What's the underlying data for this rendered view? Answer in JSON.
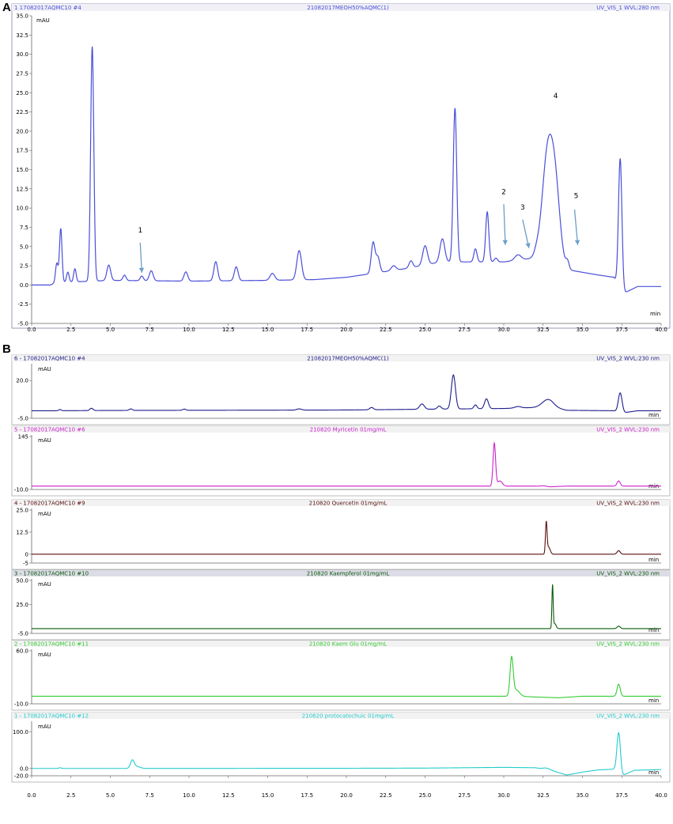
{
  "chart_data": [
    {
      "type": "line",
      "panel_label": "A",
      "header": {
        "left": "1 17082017AQMC10 #4",
        "center": "21082017MEOH50%AQMC(1)",
        "right": "UV_VIS_1 WVL:280 nm"
      },
      "ylabel": "mAU",
      "xlabel": "min",
      "xlim": [
        0.0,
        40.0
      ],
      "ylim": [
        -5.0,
        35.0
      ],
      "xticks": [
        "0.0",
        "2.5",
        "5.0",
        "7.5",
        "10.0",
        "12.5",
        "15.0",
        "17.5",
        "20.0",
        "22.5",
        "25.0",
        "27.5",
        "30.0",
        "32.5",
        "35.0",
        "37.5",
        "40.0"
      ],
      "yticks": [
        "-5.0",
        "-2.5",
        "0.0",
        "2.5",
        "5.0",
        "7.5",
        "10.0",
        "12.5",
        "15.0",
        "17.5",
        "20.0",
        "22.5",
        "25.0",
        "27.5",
        "30.0",
        "32.5",
        "35.0"
      ],
      "color": "#4a4fd8",
      "baseline": [
        [
          0.0,
          0.0
        ],
        [
          1.2,
          0.0
        ],
        [
          1.5,
          0.3
        ],
        [
          5.0,
          0.6
        ],
        [
          10.0,
          0.5
        ],
        [
          15.0,
          0.6
        ],
        [
          18.0,
          0.7
        ],
        [
          20.0,
          1.0
        ],
        [
          22.0,
          1.6
        ],
        [
          24.0,
          2.2
        ],
        [
          26.0,
          3.0
        ],
        [
          28.0,
          3.0
        ],
        [
          30.0,
          3.0
        ],
        [
          32.0,
          3.5
        ],
        [
          34.0,
          2.0
        ],
        [
          36.0,
          1.3
        ],
        [
          37.0,
          1.0
        ],
        [
          37.5,
          -1.2
        ],
        [
          38.5,
          -0.2
        ],
        [
          40.0,
          -0.2
        ]
      ],
      "peaks": [
        [
          1.6,
          2.5,
          0.08
        ],
        [
          1.85,
          7.0,
          0.08
        ],
        [
          2.3,
          1.3,
          0.08
        ],
        [
          2.75,
          1.7,
          0.08
        ],
        [
          3.85,
          30.5,
          0.1
        ],
        [
          4.9,
          2.0,
          0.12
        ],
        [
          5.9,
          0.7,
          0.1
        ],
        [
          7.0,
          0.6,
          0.1
        ],
        [
          7.6,
          1.3,
          0.12
        ],
        [
          9.8,
          1.2,
          0.12
        ],
        [
          11.7,
          2.5,
          0.12
        ],
        [
          13.0,
          1.8,
          0.12
        ],
        [
          15.3,
          0.9,
          0.15
        ],
        [
          17.0,
          3.8,
          0.15
        ],
        [
          21.7,
          4.0,
          0.12
        ],
        [
          22.0,
          2.0,
          0.12
        ],
        [
          23.0,
          0.6,
          0.15
        ],
        [
          24.1,
          0.9,
          0.12
        ],
        [
          25.0,
          2.5,
          0.15
        ],
        [
          26.1,
          3.0,
          0.15
        ],
        [
          26.9,
          20.0,
          0.11
        ],
        [
          28.2,
          1.7,
          0.1
        ],
        [
          28.95,
          6.5,
          0.1
        ],
        [
          29.5,
          0.5,
          0.1
        ],
        [
          30.9,
          0.7,
          0.2
        ],
        [
          32.1,
          0.5,
          0.15
        ],
        [
          32.8,
          14.0,
          0.35
        ],
        [
          33.3,
          8.0,
          0.3
        ],
        [
          34.05,
          1.0,
          0.1
        ],
        [
          37.4,
          17.2,
          0.11
        ]
      ],
      "annotations": [
        {
          "label": "1",
          "x": 6.9,
          "y": 6.8,
          "arrow_from": [
            6.9,
            5.5
          ],
          "arrow_to": [
            7.0,
            1.6
          ]
        },
        {
          "label": "2",
          "x": 30.0,
          "y": 11.8,
          "arrow_from": [
            30.0,
            10.5
          ],
          "arrow_to": [
            30.1,
            5.2
          ]
        },
        {
          "label": "3",
          "x": 31.2,
          "y": 9.8,
          "arrow_from": [
            31.2,
            8.5
          ],
          "arrow_to": [
            31.6,
            4.8
          ]
        },
        {
          "label": "4",
          "x": 33.3,
          "y": 24.3,
          "arrow_from": null,
          "arrow_to": null
        },
        {
          "label": "5",
          "x": 34.6,
          "y": 11.3,
          "arrow_from": [
            34.5,
            9.8
          ],
          "arrow_to": [
            34.7,
            5.2
          ]
        }
      ]
    },
    {
      "panel_label": "B",
      "type": "line",
      "xlabel": "min",
      "xlim": [
        0.0,
        40.0
      ],
      "xticks": [
        "0.0",
        "2.5",
        "5.0",
        "7.5",
        "10.0",
        "12.5",
        "15.0",
        "17.5",
        "20.0",
        "22.5",
        "25.0",
        "27.5",
        "30.0",
        "32.5",
        "35.0",
        "37.5",
        "40.0"
      ],
      "panels": [
        {
          "header": {
            "left": "6 - 17082017AQMC10 #4",
            "center": "21082017MEOH50%AQMC(1)",
            "right": "UV_VIS_2 WVL:230 nm"
          },
          "ylabel": "mAU",
          "unit": "min",
          "color": "#1c1c8c",
          "ylim": [
            -5.0,
            30.0
          ],
          "yticks": [
            "-5.0",
            "20.0"
          ],
          "baseline": [
            [
              0.0,
              0.0
            ],
            [
              1.5,
              0.0
            ],
            [
              5.0,
              0.2
            ],
            [
              20.0,
              0.5
            ],
            [
              25.0,
              1.0
            ],
            [
              30.0,
              1.5
            ],
            [
              33.0,
              2.5
            ],
            [
              34.0,
              0.3
            ],
            [
              37.0,
              0.0
            ],
            [
              37.5,
              -1.5
            ],
            [
              38.5,
              0.0
            ],
            [
              40.0,
              0.0
            ]
          ],
          "peaks": [
            [
              1.8,
              0.8,
              0.08
            ],
            [
              3.8,
              1.5,
              0.1
            ],
            [
              6.3,
              1.0,
              0.1
            ],
            [
              9.7,
              0.8,
              0.1
            ],
            [
              17.0,
              0.8,
              0.15
            ],
            [
              21.6,
              1.5,
              0.12
            ],
            [
              24.8,
              3.5,
              0.15
            ],
            [
              25.9,
              2.0,
              0.12
            ],
            [
              26.8,
              22.5,
              0.13
            ],
            [
              28.2,
              2.5,
              0.1
            ],
            [
              28.9,
              6.5,
              0.12
            ],
            [
              30.9,
              1.0,
              0.2
            ],
            [
              32.8,
              5.0,
              0.35
            ],
            [
              37.4,
              13.0,
              0.12
            ]
          ]
        },
        {
          "header": {
            "left": "5 - 17082017AQMC10 #6",
            "center": "210820 Myricetin 01mg/mL",
            "right": "UV_VIS_2 WVL:230 nm"
          },
          "ylabel": "mAU",
          "unit": "min",
          "color": "#cc22cc",
          "ylim": [
            -10.0,
            145.0
          ],
          "yticks": [
            "-10.0",
            "145"
          ],
          "baseline": [
            [
              0.0,
              0.0
            ],
            [
              29.0,
              0.0
            ],
            [
              32.0,
              0.0
            ],
            [
              33.0,
              -2.0
            ],
            [
              34.0,
              0.0
            ],
            [
              40.0,
              0.0
            ]
          ],
          "peaks": [
            [
              29.4,
              125.0,
              0.08
            ],
            [
              29.75,
              15.0,
              0.15
            ],
            [
              32.5,
              2.0,
              0.15
            ],
            [
              37.3,
              15.0,
              0.1
            ]
          ]
        },
        {
          "header": {
            "left": "4 - 17082017AQMC10 #9",
            "center": "210820 Quercetin 01mg/mL",
            "right": "UV_VIS_2 WVL:230 nm"
          },
          "ylabel": "mAU",
          "unit": "min",
          "color": "#5a1010",
          "ylim": [
            -5.0,
            25.0
          ],
          "yticks": [
            "-5",
            "0",
            "12.5",
            "25.0"
          ],
          "baseline": [
            [
              0.0,
              0.0
            ],
            [
              40.0,
              0.0
            ]
          ],
          "peaks": [
            [
              32.7,
              17.5,
              0.05
            ],
            [
              32.85,
              4.0,
              0.1
            ],
            [
              37.3,
              2.0,
              0.1
            ]
          ]
        },
        {
          "header": {
            "left": "3 - 17082017AQMC10 #10",
            "center": "210820 Kaempferol 01mg/mL",
            "right": "UV_VIS_2 WVL:230 nm"
          },
          "ylabel": "mAU",
          "unit": "min",
          "color": "#0a5a0a",
          "ylim": [
            -5.0,
            50.0
          ],
          "yticks": [
            "-5.0",
            "25.0",
            "50.0"
          ],
          "baseline": [
            [
              0.0,
              0.0
            ],
            [
              40.0,
              0.0
            ]
          ],
          "peaks": [
            [
              33.1,
              45.0,
              0.04
            ],
            [
              33.25,
              5.0,
              0.08
            ],
            [
              37.3,
              2.5,
              0.1
            ]
          ]
        },
        {
          "header": {
            "left": "2 - 17082017AQMC10 #11",
            "center": "210820 Kaem Glu 01mg/mL",
            "right": "UV_VIS_2 WVL:230 nm"
          },
          "ylabel": "mAU",
          "unit": "min",
          "color": "#33cc33",
          "ylim": [
            -10.0,
            60.0
          ],
          "yticks": [
            "-10.0",
            "60.0"
          ],
          "baseline": [
            [
              0.0,
              0.0
            ],
            [
              31.0,
              0.0
            ],
            [
              32.0,
              -1.0
            ],
            [
              33.5,
              -2.0
            ],
            [
              35.0,
              0.0
            ],
            [
              40.0,
              0.0
            ]
          ],
          "peaks": [
            [
              30.5,
              50.0,
              0.1
            ],
            [
              30.8,
              8.0,
              0.2
            ],
            [
              37.3,
              16.0,
              0.1
            ]
          ]
        },
        {
          "header": {
            "left": "1 - 17082017AQMC10 #12",
            "center": "210820 protocatechuic 01mg/mL",
            "right": "UV_VIS_2 WVL:230 nm"
          },
          "ylabel": "mAU",
          "unit": "min",
          "color": "#22cccc",
          "ylim": [
            -20.0,
            125.0
          ],
          "yticks": [
            "-20.0",
            "0.0",
            "100.0"
          ],
          "baseline": [
            [
              0.0,
              0.0
            ],
            [
              5.0,
              0.0
            ],
            [
              20.0,
              0.5
            ],
            [
              25.0,
              1.0
            ],
            [
              30.0,
              3.0
            ],
            [
              32.0,
              2.0
            ],
            [
              33.0,
              -5.0
            ],
            [
              34.0,
              -18.0
            ],
            [
              35.0,
              -10.0
            ],
            [
              36.0,
              -4.0
            ],
            [
              37.0,
              -2.0
            ],
            [
              37.6,
              -18.0
            ],
            [
              38.3,
              -5.0
            ],
            [
              40.0,
              -3.0
            ]
          ],
          "peaks": [
            [
              1.8,
              2.0,
              0.08
            ],
            [
              6.4,
              22.0,
              0.12
            ],
            [
              6.7,
              5.0,
              0.2
            ],
            [
              32.7,
              4.0,
              0.2
            ],
            [
              37.3,
              108.0,
              0.11
            ]
          ]
        }
      ]
    }
  ]
}
